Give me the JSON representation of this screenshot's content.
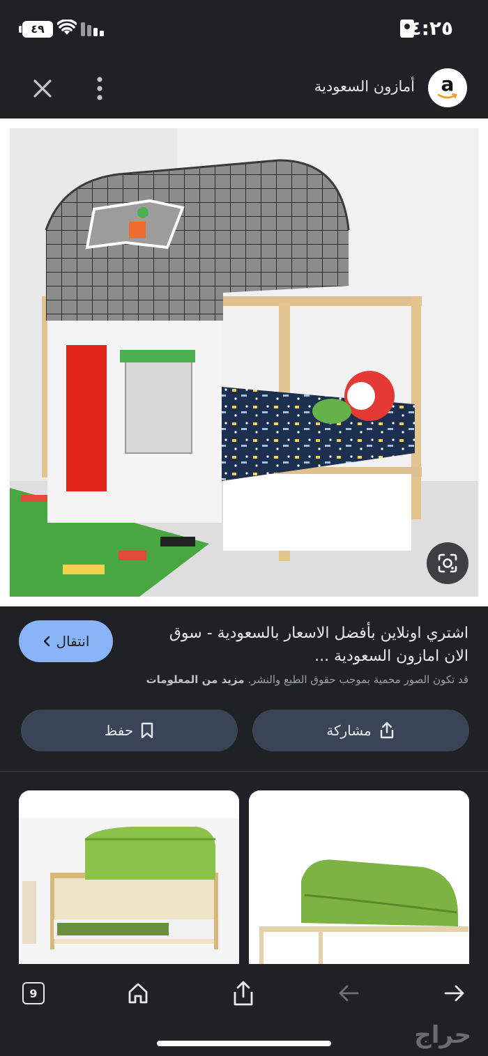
{
  "status_bar": {
    "time": "٤:٢٥",
    "battery": "٤٩"
  },
  "header": {
    "site_name": "أمازون السعودية",
    "logo_letter": "a"
  },
  "result": {
    "title": "اشتري اونلاين بأفضل الاسعار بالسعودية - سوق الان امازون السعودية ...",
    "visit_label": "انتقال",
    "notice_text": "قد تكون الصور محمية بموجب حقوق الطبع والنشر.",
    "notice_link": "مزيد من المعلومات",
    "share_label": "مشاركة",
    "save_label": "حفظ"
  },
  "bottom_nav": {
    "tabs_count": "9"
  },
  "watermark": "حراج",
  "icons": {
    "close": "close-icon",
    "more": "more-vert-icon",
    "lens": "lens-icon",
    "share": "share-icon",
    "bookmark": "bookmark-icon",
    "home": "home-icon",
    "back": "arrow-back-icon",
    "forward": "arrow-forward-icon"
  },
  "colors": {
    "accent": "#8ab4f8",
    "pill_bg": "#394457",
    "background": "#1f2125"
  }
}
